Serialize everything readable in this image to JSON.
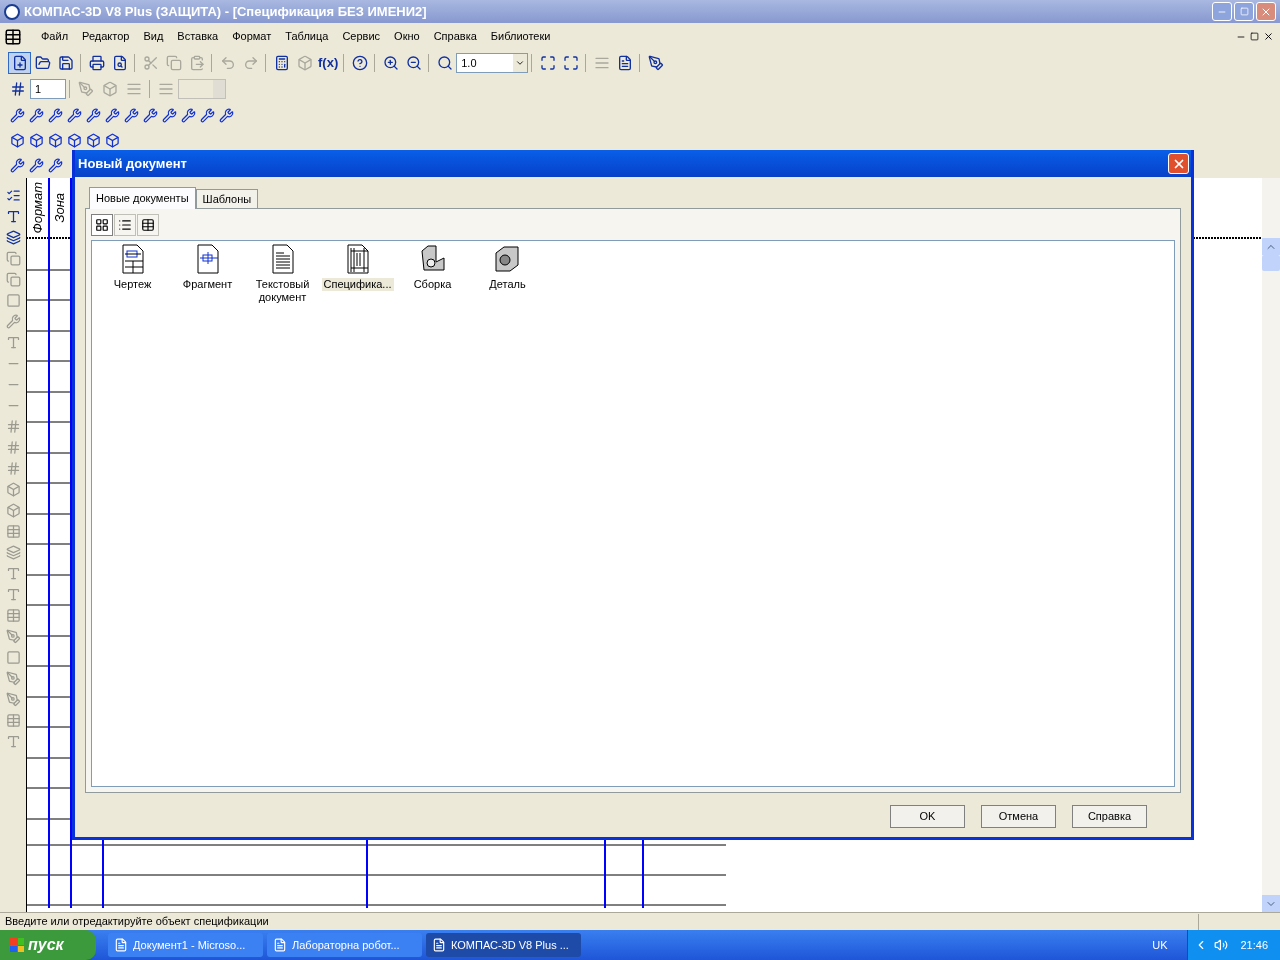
{
  "window": {
    "title": "КОМПАС-3D V8 Plus (ЗАЩИТА) - [Спецификация БЕЗ ИМЕНИ2]"
  },
  "menu": [
    "Файл",
    "Редактор",
    "Вид",
    "Вставка",
    "Формат",
    "Таблица",
    "Сервис",
    "Окно",
    "Справка",
    "Библиотеки"
  ],
  "main_toolbar": [
    [
      {
        "kind": "new",
        "disabled": false
      },
      {
        "kind": "open",
        "disabled": false
      },
      {
        "kind": "save",
        "disabled": false
      }
    ],
    [
      {
        "kind": "print",
        "disabled": false
      },
      {
        "kind": "preview",
        "disabled": false
      }
    ],
    [
      {
        "kind": "cut",
        "disabled": true
      },
      {
        "kind": "copy",
        "disabled": true
      },
      {
        "kind": "paste",
        "disabled": true
      }
    ],
    [
      {
        "kind": "undo",
        "disabled": true
      },
      {
        "kind": "redo",
        "disabled": true
      }
    ],
    [
      {
        "kind": "calc",
        "disabled": false
      },
      {
        "kind": "model",
        "disabled": true
      },
      {
        "kind": "fx",
        "disabled": false,
        "label": "f(x)"
      }
    ],
    [
      {
        "kind": "help",
        "disabled": false
      }
    ],
    [
      {
        "kind": "zoomin",
        "disabled": false
      },
      {
        "kind": "zoomout",
        "disabled": false
      }
    ],
    [
      {
        "kind": "zoombox",
        "disabled": false
      },
      {
        "kind": "zoomcombo",
        "disabled": false,
        "label": "1.0"
      }
    ],
    [
      {
        "kind": "fit",
        "disabled": false
      },
      {
        "kind": "fit",
        "disabled": false
      }
    ],
    [
      {
        "kind": "lines",
        "disabled": true
      },
      {
        "kind": "page",
        "disabled": false
      }
    ],
    [
      {
        "kind": "pen",
        "disabled": false
      }
    ]
  ],
  "page_field": {
    "value": "1"
  },
  "spec_table": {
    "columns": [
      "Формат",
      "Зона"
    ]
  },
  "dialog": {
    "title": "Новый документ",
    "tabs": [
      {
        "label": "Новые документы",
        "selected": true
      },
      {
        "label": "Шаблоны",
        "selected": false
      }
    ],
    "view_modes": [
      {
        "kind": "large",
        "selected": true
      },
      {
        "kind": "small",
        "selected": false
      },
      {
        "kind": "details",
        "selected": false
      }
    ],
    "items": [
      {
        "kind": "drawing",
        "label": "Чертеж",
        "selected": false
      },
      {
        "kind": "fragment",
        "label": "Фрагмент",
        "selected": false
      },
      {
        "kind": "text",
        "label": "Текстовый документ",
        "selected": false
      },
      {
        "kind": "spec",
        "label": "Специфика...",
        "selected": true
      },
      {
        "kind": "assembly",
        "label": "Сборка",
        "selected": false
      },
      {
        "kind": "part",
        "label": "Деталь",
        "selected": false
      }
    ],
    "buttons": [
      "OK",
      "Отмена",
      "Справка"
    ]
  },
  "status_bar": {
    "text": "Введите или отредактируйте объект спецификации"
  },
  "taskbar": {
    "start": "пуск",
    "tasks": [
      {
        "label": "Документ1 - Microso...",
        "selected": false
      },
      {
        "label": "Лабораторна робот...",
        "selected": false
      },
      {
        "label": "КОМПАС-3D V8 Plus ...",
        "selected": true
      }
    ],
    "language": "UK",
    "clock": "21:46"
  }
}
